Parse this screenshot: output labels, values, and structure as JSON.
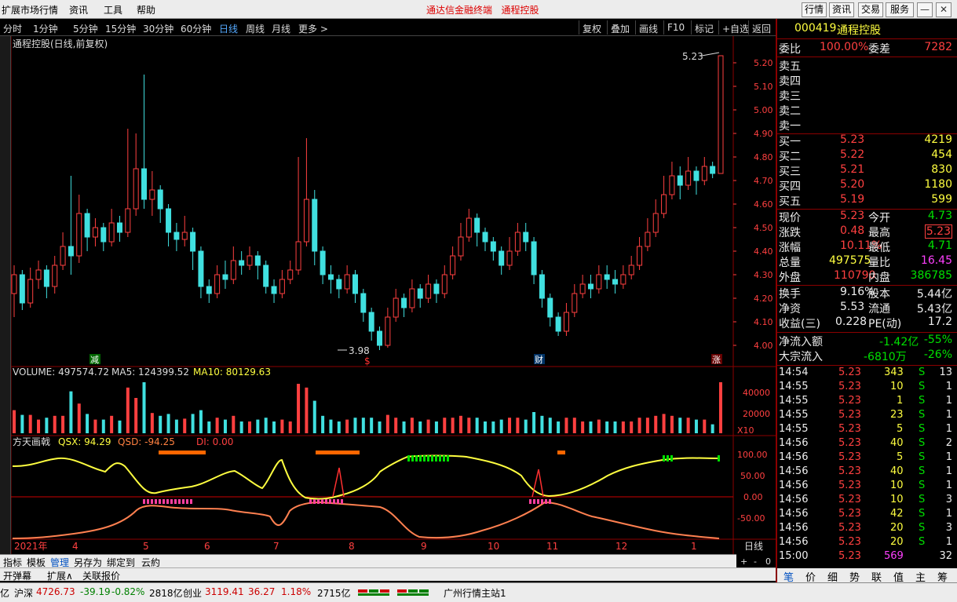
{
  "menu": {
    "items": [
      "扩展市场行情",
      "资讯",
      "工具",
      "帮助"
    ],
    "center_left": "通达信金融终端",
    "center_right": "通程控股",
    "buttons": [
      "行情",
      "资讯",
      "交易",
      "服务"
    ]
  },
  "toolbar": {
    "periods": [
      "分时",
      "1分钟",
      "5分钟",
      "15分钟",
      "30分钟",
      "60分钟",
      "日线",
      "周线",
      "月线",
      "更多 >"
    ],
    "active": "日线",
    "right": [
      "复权",
      "叠加",
      "画线",
      "F10",
      "标记",
      "+自选",
      "返回"
    ]
  },
  "chart": {
    "title": "通程控股(日线,前复权)",
    "high_label": "5.23",
    "low_label": "3.98",
    "price_ticks": [
      "5.20",
      "5.10",
      "5.00",
      "4.90",
      "4.80",
      "4.70",
      "4.60",
      "4.50",
      "4.40",
      "4.30",
      "4.20",
      "4.10",
      "4.00"
    ],
    "markers": [
      {
        "text": "减",
        "color": "#00a000"
      },
      {
        "text": "$",
        "color": "#ff3030"
      },
      {
        "text": "财",
        "color": "#4080ff"
      },
      {
        "text": "涨",
        "color": "#ff3030"
      }
    ],
    "volume": {
      "title": "VOLUME: 497574.72",
      "ma5": "MA5: 124399.52",
      "ma10": "MA10: 80129.63",
      "ticks": [
        "40000",
        "20000"
      ],
      "unit": "X10"
    },
    "indicator": {
      "name": "方天画戟",
      "qsx": "QSX: 94.29",
      "qsd": "QSD: -94.25",
      "di": "DI: 0.00",
      "ticks": [
        "100.00",
        "50.00",
        "0.00",
        "-50.00"
      ]
    },
    "date_axis": [
      "2021年",
      "4",
      "5",
      "6",
      "7",
      "8",
      "9",
      "10",
      "11",
      "12",
      "1"
    ],
    "period_label": "日线",
    "zoom": [
      "+",
      "-",
      "0"
    ]
  },
  "chart_data": {
    "type": "candlestick",
    "title": "通程控股(日线,前复权)",
    "y_range": [
      3.95,
      5.25
    ],
    "candles": [
      [
        4.22,
        4.3,
        4.34,
        4.12
      ],
      [
        4.3,
        4.18,
        4.32,
        4.15
      ],
      [
        4.18,
        4.28,
        4.33,
        4.16
      ],
      [
        4.28,
        4.32,
        4.36,
        4.24
      ],
      [
        4.32,
        4.25,
        4.34,
        4.2
      ],
      [
        4.25,
        4.34,
        4.38,
        4.22
      ],
      [
        4.34,
        4.42,
        4.48,
        4.32
      ],
      [
        4.42,
        4.38,
        4.72,
        4.3
      ],
      [
        4.38,
        4.56,
        4.64,
        4.35
      ],
      [
        4.56,
        4.46,
        4.58,
        4.4
      ],
      [
        4.46,
        4.5,
        4.54,
        4.42
      ],
      [
        4.5,
        4.44,
        4.52,
        4.4
      ],
      [
        4.44,
        4.52,
        4.58,
        4.42
      ],
      [
        4.52,
        4.48,
        4.55,
        4.44
      ],
      [
        4.48,
        4.58,
        4.92,
        4.46
      ],
      [
        4.58,
        4.75,
        4.9,
        4.55
      ],
      [
        4.75,
        4.62,
        5.15,
        4.58
      ],
      [
        4.62,
        4.66,
        4.74,
        4.55
      ],
      [
        4.66,
        4.58,
        4.68,
        4.52
      ],
      [
        4.58,
        4.48,
        4.6,
        4.42
      ],
      [
        4.48,
        4.45,
        4.52,
        4.4
      ],
      [
        4.45,
        4.48,
        4.55,
        4.42
      ],
      [
        4.48,
        4.4,
        4.5,
        4.32
      ],
      [
        4.4,
        4.25,
        4.42,
        4.2
      ],
      [
        4.25,
        4.22,
        4.28,
        4.18
      ],
      [
        4.22,
        4.3,
        4.34,
        4.2
      ],
      [
        4.3,
        4.28,
        4.36,
        4.24
      ],
      [
        4.28,
        4.36,
        4.42,
        4.26
      ],
      [
        4.36,
        4.34,
        4.4,
        4.3
      ],
      [
        4.34,
        4.38,
        4.42,
        4.32
      ],
      [
        4.38,
        4.34,
        4.4,
        4.28
      ],
      [
        4.34,
        4.25,
        4.36,
        4.22
      ],
      [
        4.25,
        4.22,
        4.28,
        4.18
      ],
      [
        4.22,
        4.28,
        4.32,
        4.2
      ],
      [
        4.28,
        4.32,
        4.36,
        4.26
      ],
      [
        4.32,
        4.44,
        4.8,
        4.3
      ],
      [
        4.44,
        4.62,
        4.88,
        4.42
      ],
      [
        4.62,
        4.4,
        4.66,
        4.34
      ],
      [
        4.4,
        4.3,
        4.42,
        4.26
      ],
      [
        4.3,
        4.28,
        4.34,
        4.22
      ],
      [
        4.28,
        4.24,
        4.3,
        4.2
      ],
      [
        4.24,
        4.3,
        4.34,
        4.22
      ],
      [
        4.3,
        4.22,
        4.32,
        4.18
      ],
      [
        4.22,
        4.14,
        4.24,
        4.1
      ],
      [
        4.14,
        4.06,
        4.16,
        4.02
      ],
      [
        4.06,
        4.0,
        4.08,
        3.98
      ],
      [
        4.0,
        4.12,
        4.16,
        3.99
      ],
      [
        4.12,
        4.2,
        4.24,
        4.1
      ],
      [
        4.2,
        4.16,
        4.22,
        4.12
      ],
      [
        4.16,
        4.24,
        4.28,
        4.14
      ],
      [
        4.24,
        4.2,
        4.26,
        4.16
      ],
      [
        4.2,
        4.26,
        4.3,
        4.18
      ],
      [
        4.26,
        4.22,
        4.28,
        4.18
      ],
      [
        4.22,
        4.3,
        4.34,
        4.2
      ],
      [
        4.3,
        4.38,
        4.42,
        4.28
      ],
      [
        4.38,
        4.46,
        4.52,
        4.36
      ],
      [
        4.46,
        4.54,
        4.58,
        4.44
      ],
      [
        4.54,
        4.48,
        4.56,
        4.42
      ],
      [
        4.48,
        4.44,
        4.5,
        4.4
      ],
      [
        4.44,
        4.4,
        4.46,
        4.36
      ],
      [
        4.4,
        4.34,
        4.42,
        4.3
      ],
      [
        4.34,
        4.4,
        4.46,
        4.32
      ],
      [
        4.4,
        4.48,
        4.52,
        4.38
      ],
      [
        4.48,
        4.44,
        4.52,
        4.4
      ],
      [
        4.44,
        4.3,
        4.46,
        4.26
      ],
      [
        4.3,
        4.2,
        4.32,
        4.16
      ],
      [
        4.2,
        4.12,
        4.22,
        4.08
      ],
      [
        4.12,
        4.06,
        4.14,
        4.04
      ],
      [
        4.06,
        4.14,
        4.18,
        4.04
      ],
      [
        4.14,
        4.22,
        4.26,
        4.12
      ],
      [
        4.22,
        4.26,
        4.3,
        4.2
      ],
      [
        4.26,
        4.24,
        4.3,
        4.2
      ],
      [
        4.24,
        4.3,
        4.34,
        4.22
      ],
      [
        4.3,
        4.28,
        4.34,
        4.24
      ],
      [
        4.28,
        4.26,
        4.32,
        4.22
      ],
      [
        4.26,
        4.3,
        4.34,
        4.24
      ],
      [
        4.3,
        4.34,
        4.38,
        4.28
      ],
      [
        4.34,
        4.42,
        4.46,
        4.32
      ],
      [
        4.42,
        4.48,
        4.54,
        4.4
      ],
      [
        4.48,
        4.56,
        4.62,
        4.46
      ],
      [
        4.56,
        4.64,
        4.72,
        4.54
      ],
      [
        4.64,
        4.72,
        4.78,
        4.62
      ],
      [
        4.72,
        4.68,
        4.76,
        4.62
      ],
      [
        4.68,
        4.74,
        4.8,
        4.66
      ],
      [
        4.74,
        4.7,
        4.76,
        4.64
      ],
      [
        4.7,
        4.76,
        4.8,
        4.68
      ],
      [
        4.76,
        4.73,
        4.78,
        4.71
      ],
      [
        4.73,
        5.23,
        5.23,
        4.73
      ]
    ]
  },
  "right": {
    "code": "000419",
    "name": "通程控股",
    "weibi_label": "委比",
    "weibi": "100.00%",
    "weicha_label": "委差",
    "weicha": "7282",
    "sells": [
      "卖五",
      "卖四",
      "卖三",
      "卖二",
      "卖一"
    ],
    "buys": [
      {
        "l": "买一",
        "p": "5.23",
        "v": "4219"
      },
      {
        "l": "买二",
        "p": "5.22",
        "v": "454"
      },
      {
        "l": "买三",
        "p": "5.21",
        "v": "830"
      },
      {
        "l": "买四",
        "p": "5.20",
        "v": "1180"
      },
      {
        "l": "买五",
        "p": "5.19",
        "v": "599"
      }
    ],
    "quote": [
      {
        "l1": "现价",
        "v1": "5.23",
        "l2": "今开",
        "v2": "4.73"
      },
      {
        "l1": "涨跌",
        "v1": "0.48",
        "l2": "最高",
        "v2": "5.23"
      },
      {
        "l1": "涨幅",
        "v1": "10.11%",
        "l2": "最低",
        "v2": "4.71"
      },
      {
        "l1": "总量",
        "v1": "497575",
        "l2": "量比",
        "v2": "16.45"
      },
      {
        "l1": "外盘",
        "v1": "110790",
        "l2": "内盘",
        "v2": "386785"
      }
    ],
    "fund": [
      {
        "l1": "换手",
        "v1": "9.16%",
        "l2": "股本",
        "v2": "5.44亿"
      },
      {
        "l1": "净资",
        "v1": "5.53",
        "l2": "流通",
        "v2": "5.43亿"
      },
      {
        "l1": "收益(三)",
        "v1": "0.228",
        "l2": "PE(动)",
        "v2": "17.2"
      }
    ],
    "flow": [
      {
        "l": "净流入额",
        "v": "-1.42亿",
        "p": "-55%"
      },
      {
        "l": "大宗流入",
        "v": "-6810万",
        "p": "-26%"
      }
    ],
    "ticks": [
      {
        "t": "14:54",
        "p": "5.23",
        "v": "343",
        "s": "S",
        "n": "13"
      },
      {
        "t": "14:55",
        "p": "5.23",
        "v": "10",
        "s": "S",
        "n": "1"
      },
      {
        "t": "14:55",
        "p": "5.23",
        "v": "1",
        "s": "S",
        "n": "1"
      },
      {
        "t": "14:55",
        "p": "5.23",
        "v": "23",
        "s": "S",
        "n": "1"
      },
      {
        "t": "14:55",
        "p": "5.23",
        "v": "5",
        "s": "S",
        "n": "1"
      },
      {
        "t": "14:56",
        "p": "5.23",
        "v": "40",
        "s": "S",
        "n": "2"
      },
      {
        "t": "14:56",
        "p": "5.23",
        "v": "5",
        "s": "S",
        "n": "1"
      },
      {
        "t": "14:56",
        "p": "5.23",
        "v": "40",
        "s": "S",
        "n": "1"
      },
      {
        "t": "14:56",
        "p": "5.23",
        "v": "10",
        "s": "S",
        "n": "1"
      },
      {
        "t": "14:56",
        "p": "5.23",
        "v": "10",
        "s": "S",
        "n": "3"
      },
      {
        "t": "14:56",
        "p": "5.23",
        "v": "42",
        "s": "S",
        "n": "1"
      },
      {
        "t": "14:56",
        "p": "5.23",
        "v": "20",
        "s": "S",
        "n": "3"
      },
      {
        "t": "14:56",
        "p": "5.23",
        "v": "20",
        "s": "S",
        "n": "1"
      },
      {
        "t": "15:00",
        "p": "5.23",
        "v": "569",
        "s": "",
        "n": "32"
      }
    ],
    "bottom_tabs": [
      "笔",
      "价",
      "细",
      "势",
      "联",
      "值",
      "主",
      "筹"
    ]
  },
  "bottom": {
    "tabs1": [
      "指标",
      "模板",
      "管理",
      "另存为",
      "绑定到",
      "云約"
    ],
    "tabs2": [
      "开弹幕",
      "扩展∧",
      "关联报价"
    ]
  },
  "status": {
    "lead": "亿",
    "name1": "沪深",
    "v1": "4726.73",
    "c1": "-39.19",
    "p1": "-0.82%",
    "a1": "2818亿",
    "name2": "创业",
    "v2": "3119.41",
    "c2": "36.27",
    "p2": "1.18%",
    "a2": "2715亿",
    "server": "广州行情主站1"
  }
}
